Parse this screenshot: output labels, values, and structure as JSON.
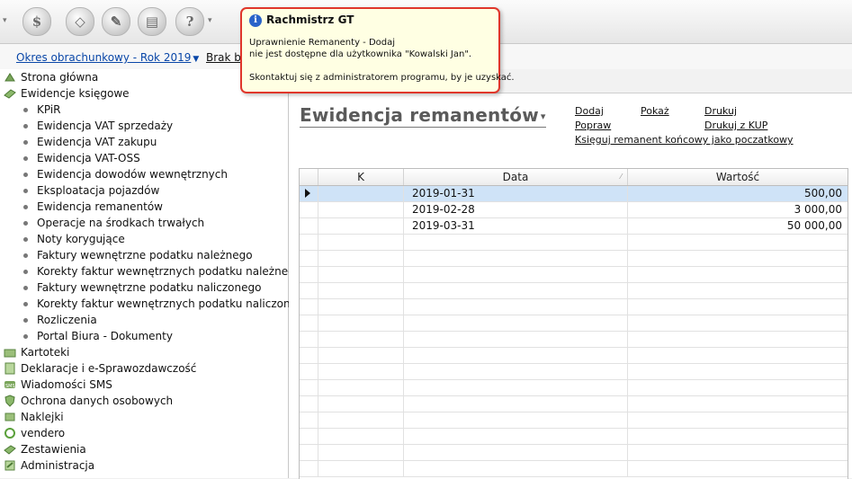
{
  "toolbar": {
    "buttons": [
      {
        "name": "settings",
        "icon": "dollar-gear-icon"
      },
      {
        "name": "eraser",
        "icon": "eraser-icon"
      },
      {
        "name": "tools",
        "icon": "tools-icon"
      },
      {
        "name": "print",
        "icon": "printer-icon"
      },
      {
        "name": "help",
        "icon": "help-icon"
      }
    ]
  },
  "subbar": {
    "period_label": "Okres obrachunkowy - Rok 2019",
    "brak_label": "Brak blo"
  },
  "sidebar": {
    "items": [
      {
        "label": "Strona główna",
        "icon": "home-money-icon"
      },
      {
        "label": "Ewidencje księgowe",
        "icon": "ledger-icon"
      }
    ],
    "subitems": [
      "KPiR",
      "Ewidencja VAT sprzedaży",
      "Ewidencja VAT zakupu",
      "Ewidencja VAT-OSS",
      "Ewidencja dowodów wewnętrznych",
      "Eksploatacja pojazdów",
      "Ewidencja remanentów",
      "Operacje na środkach trwałych",
      "Noty korygujące",
      "Faktury wewnętrzne podatku należnego",
      "Korekty faktur wewnętrznych podatku należnego",
      "Faktury wewnętrzne podatku naliczonego",
      "Korekty faktur wewnętrznych podatku naliczonego",
      "Rozliczenia",
      "Portal Biura - Dokumenty"
    ],
    "bottom_items": [
      {
        "label": "Kartoteki",
        "icon": "folder-icon"
      },
      {
        "label": "Deklaracje i e-Sprawozdawczość",
        "icon": "declaration-icon"
      },
      {
        "label": "Wiadomości SMS",
        "icon": "sms-icon"
      },
      {
        "label": "Ochrona danych osobowych",
        "icon": "shield-icon"
      },
      {
        "label": "Naklejki",
        "icon": "sticker-icon"
      },
      {
        "label": "vendero",
        "icon": "vendero-icon"
      },
      {
        "label": "Zestawienia",
        "icon": "report-icon"
      },
      {
        "label": "Administracja",
        "icon": "admin-icon"
      }
    ]
  },
  "main": {
    "title": "Ewidencja remanentów",
    "actions": {
      "dodaj": "Dodaj",
      "popraw": "Popraw",
      "pokaz": "Pokaż",
      "drukuj": "Drukuj",
      "drukuj_kup": "Drukuj z KUP",
      "ksieguj": "Księguj remanent końcowy jako poczatkowy"
    },
    "table": {
      "columns": [
        "K",
        "Data",
        "Wartość"
      ],
      "rows": [
        {
          "k": "",
          "date": "2019-01-31",
          "value": "500,00",
          "selected": true
        },
        {
          "k": "",
          "date": "2019-02-28",
          "value": "3 000,00",
          "selected": false
        },
        {
          "k": "",
          "date": "2019-03-31",
          "value": "50 000,00",
          "selected": false
        }
      ]
    }
  },
  "tooltip": {
    "title": "Rachmistrz GT",
    "line1": "Uprawnienie Remanenty - Dodaj",
    "line2": "nie jest dostępne dla użytkownika \"Kowalski Jan\".",
    "line3": "Skontaktuj się z administratorem programu, by je uzyskać."
  }
}
